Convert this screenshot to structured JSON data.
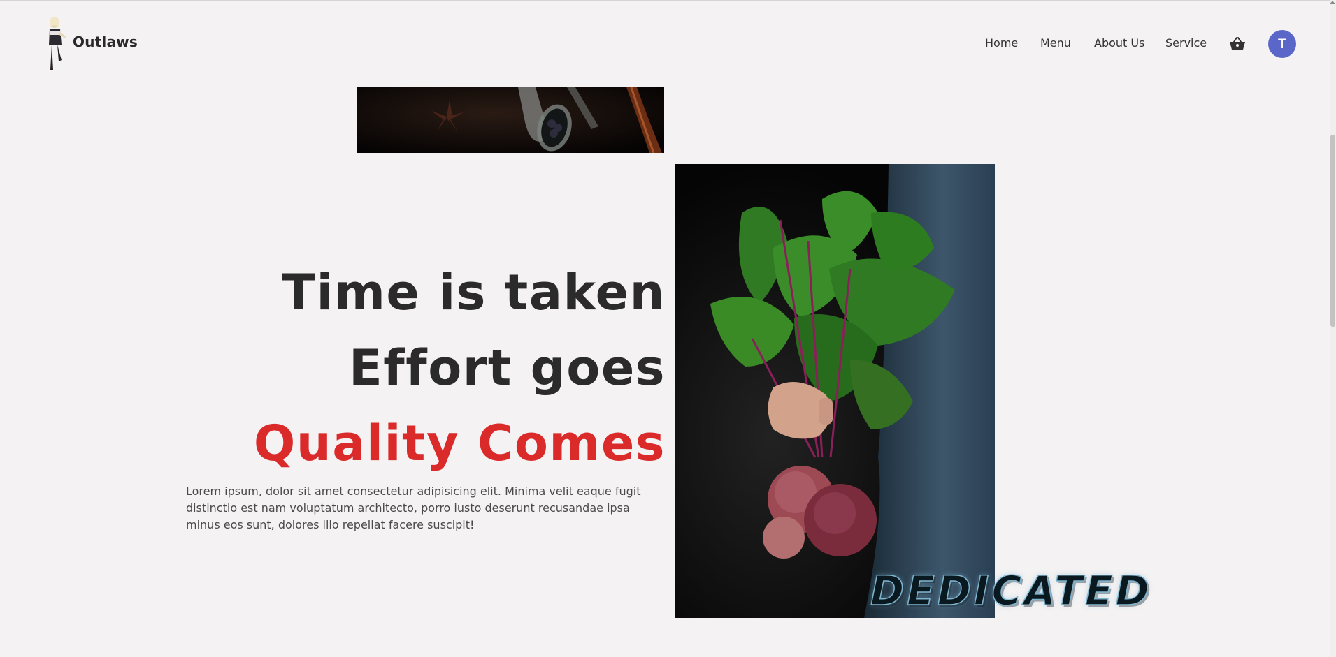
{
  "brand": {
    "name": "Outlaws"
  },
  "nav": {
    "items": [
      {
        "label": "Home"
      },
      {
        "label": "Menu"
      },
      {
        "label": "About Us"
      },
      {
        "label": "Service"
      }
    ],
    "cart_icon": "shopping-basket-icon",
    "avatar_initial": "T"
  },
  "hero": {
    "line1": "Time is taken",
    "line2": "Effort goes",
    "line3": "Quality Comes",
    "description": "Lorem ipsum, dolor sit amet consectetur adipisicing elit. Minima velit eaque fugit distinctio est nam voluptatum architecto, porro iusto deserunt recusandae ipsa minus eos sunt, dolores illo repellat facere suscipit!",
    "badge": "DEDICATED"
  },
  "colors": {
    "background": "#f4f2f3",
    "headline": "#2b2b2b",
    "accent_red": "#db2a2a",
    "avatar": "#5b67c8"
  }
}
